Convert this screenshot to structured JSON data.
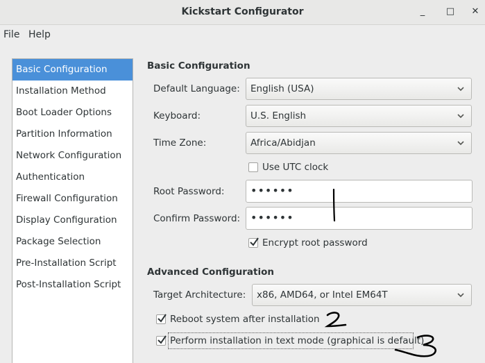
{
  "window": {
    "title": "Kickstart Configurator",
    "minimize_glyph": "_",
    "maximize_glyph": "□",
    "close_glyph": "✕"
  },
  "menu": {
    "file": "File",
    "help": "Help"
  },
  "sidebar": {
    "items": [
      {
        "label": "Basic Configuration",
        "selected": true
      },
      {
        "label": "Installation Method"
      },
      {
        "label": "Boot Loader Options"
      },
      {
        "label": "Partition Information"
      },
      {
        "label": "Network Configuration"
      },
      {
        "label": "Authentication"
      },
      {
        "label": "Firewall Configuration"
      },
      {
        "label": "Display Configuration"
      },
      {
        "label": "Package Selection"
      },
      {
        "label": "Pre-Installation Script"
      },
      {
        "label": "Post-Installation Script"
      }
    ]
  },
  "basic": {
    "heading": "Basic Configuration",
    "language_label": "Default Language:",
    "language_value": "English (USA)",
    "keyboard_label": "Keyboard:",
    "keyboard_value": "U.S. English",
    "timezone_label": "Time Zone:",
    "timezone_value": "Africa/Abidjan",
    "utc_label": "Use UTC clock",
    "utc_checked": false,
    "root_pw_label": "Root Password:",
    "root_pw_value": "••••••",
    "confirm_pw_label": "Confirm Password:",
    "confirm_pw_value": "••••••",
    "encrypt_label": "Encrypt root password",
    "encrypt_checked": true
  },
  "advanced": {
    "heading": "Advanced Configuration",
    "arch_label": "Target Architecture:",
    "arch_value": "x86, AMD64, or Intel EM64T",
    "reboot_label": "Reboot system after installation",
    "reboot_checked": true,
    "textmode_label": "Perform installation in text mode (graphical is default)",
    "textmode_checked": true
  },
  "icons": {
    "dropdown": "chevron-down-icon",
    "check": "checkmark-icon"
  }
}
